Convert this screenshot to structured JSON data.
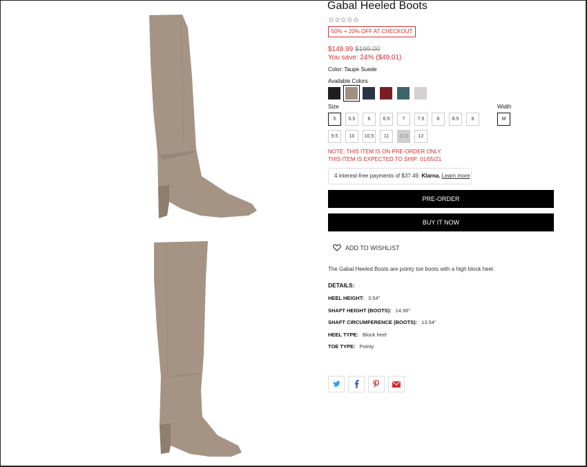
{
  "product": {
    "title": "Gabal Heeled Boots",
    "rating_stars": "☆☆☆☆☆",
    "promo": "50% + 20% OFF AT CHECKOUT",
    "price": "$149.99",
    "original_price": "$199.00",
    "savings": "You save: 24% ($49.01)",
    "color_label": "Color: Taupe Suede",
    "available_colors_label": "Available Colors",
    "colors": [
      "#1f1f1f",
      "#a09080",
      "#2c3346",
      "#7a1e24",
      "#3d6466",
      "#d6d0d0"
    ],
    "selected_color_index": 1,
    "size_label": "Size",
    "sizes": [
      "5",
      "5.5",
      "6",
      "6.5",
      "7",
      "7.5",
      "8",
      "8.5",
      "9",
      "9.5",
      "10",
      "10.5",
      "11",
      "11.5",
      "12"
    ],
    "selected_size": "5",
    "disabled_size": "11.5",
    "width_label": "Width",
    "width_value": "M",
    "note_line1": "NOTE: THIS ITEM IS ON PRE-ORDER ONLY.",
    "note_line2": "THIS ITEM IS EXPECTED TO SHIP: 01/05/21"
  },
  "klarna": {
    "text": "4 interest-free payments of $37.49.",
    "brand": "Klarna.",
    "learn_more": "Learn more"
  },
  "actions": {
    "preorder": "PRE-ORDER",
    "buy_now": "BUY IT NOW",
    "wishlist": "ADD TO WISHLIST"
  },
  "description": "The Gabal Heeled Boots are pointy toe boots with a high block heel.",
  "details": {
    "heading": "DETAILS:",
    "specs": [
      {
        "key": "HEEL HEIGHT:",
        "value": "3.54\""
      },
      {
        "key": "SHAFT HEIGHT (BOOTS):",
        "value": "14.96\""
      },
      {
        "key": "SHAFT CIRCUMFERENCE (BOOTS):",
        "value": "13.54\""
      },
      {
        "key": "HEEL TYPE:",
        "value": "Block heel"
      },
      {
        "key": "TOE TYPE:",
        "value": "Pointy"
      }
    ]
  },
  "share": {
    "icons": [
      "twitter-icon",
      "facebook-icon",
      "pinterest-icon",
      "email-icon"
    ]
  },
  "colors": {
    "accent_red": "#d32f2f",
    "button_black": "#000000"
  }
}
